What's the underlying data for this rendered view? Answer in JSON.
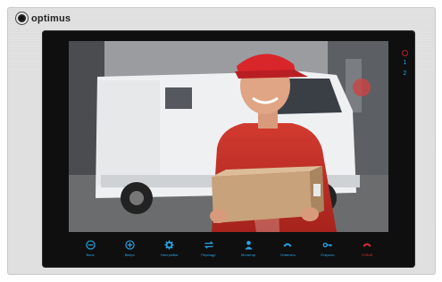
{
  "brand": {
    "name": "optimus"
  },
  "indicators": {
    "ch1": "1",
    "ch2": "2",
    "power_color": "#b0202a"
  },
  "colors": {
    "accent": "#2aa5e6",
    "hangup": "#e0303a"
  },
  "controls": [
    {
      "label": "Вниз",
      "icon": "minus-circle-icon"
    },
    {
      "label": "Вверх",
      "icon": "plus-circle-icon"
    },
    {
      "label": "Настройки",
      "icon": "gear-icon"
    },
    {
      "label": "Переадр.",
      "icon": "transfer-icon"
    },
    {
      "label": "Монитор",
      "icon": "person-icon"
    },
    {
      "label": "Ответить",
      "icon": "handset-icon"
    },
    {
      "label": "Открыть",
      "icon": "key-icon"
    },
    {
      "label": "Отбой",
      "icon": "hangup-icon"
    }
  ]
}
